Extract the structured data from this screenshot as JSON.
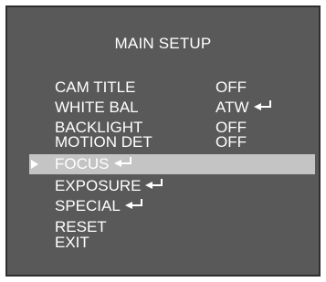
{
  "menu": {
    "title": "MAIN SETUP",
    "items": [
      {
        "label": "CAM TITLE",
        "value": "OFF"
      },
      {
        "label": "WHITE BAL",
        "value": "ATW",
        "icon": "enter-icon"
      },
      {
        "label": "BACKLIGHT",
        "value": "OFF"
      },
      {
        "label": "MOTION DET",
        "value": "OFF"
      },
      {
        "label": "FOCUS",
        "icon": "enter-icon",
        "selected": true
      },
      {
        "label": "EXPOSURE",
        "icon": "enter-icon"
      },
      {
        "label": "SPECIAL",
        "icon": "enter-icon"
      },
      {
        "label": "RESET"
      },
      {
        "label": "EXIT"
      }
    ]
  },
  "colors": {
    "panel_bg": "#595959",
    "highlight_bg": "#c4c4c4",
    "text": "#ffffff"
  }
}
